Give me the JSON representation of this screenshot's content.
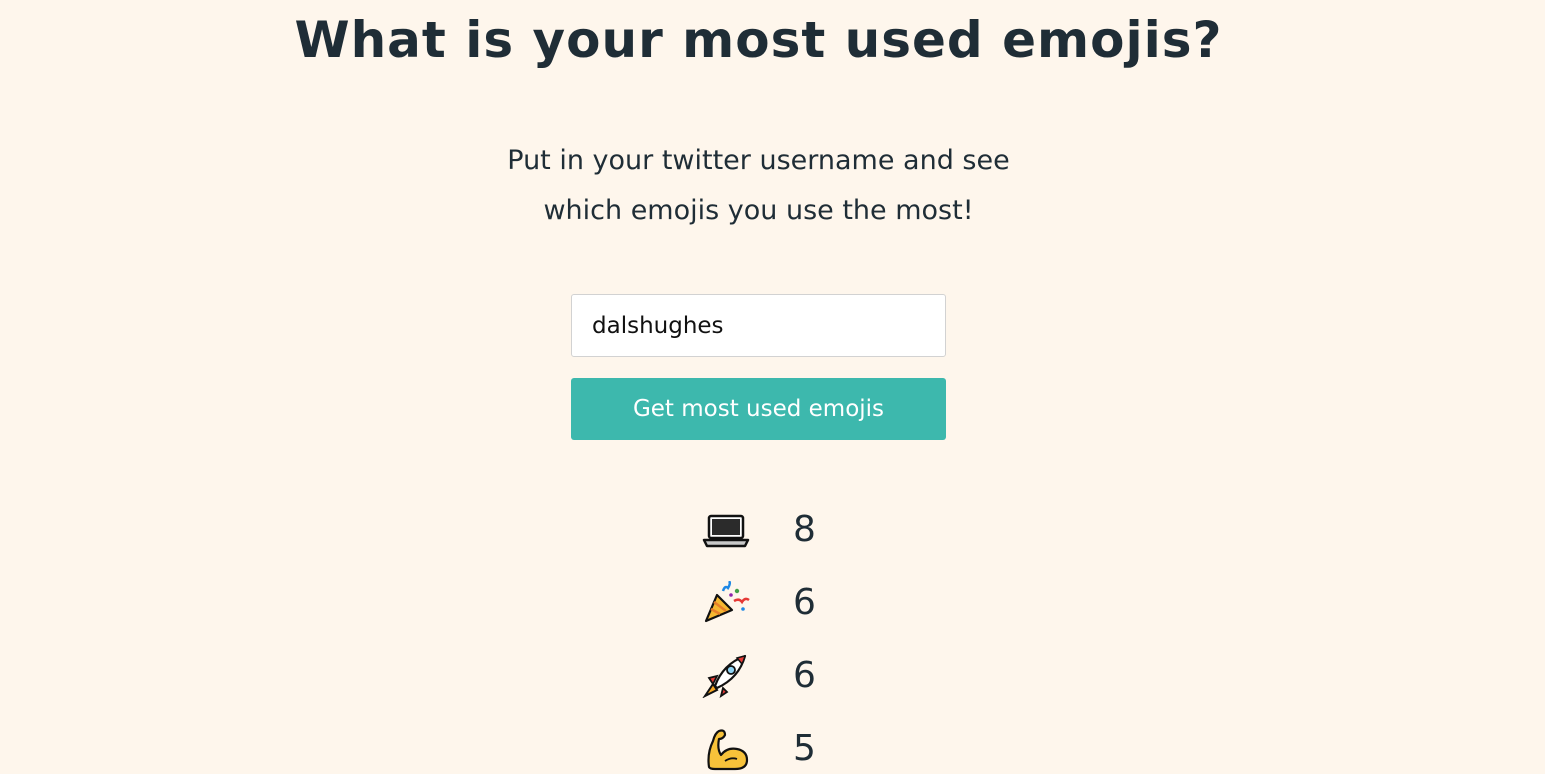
{
  "page": {
    "title": "What is your most used emojis?",
    "subtitle_line1": "Put in your twitter username and see",
    "subtitle_line2": "which emojis you use the most!"
  },
  "form": {
    "username_value": "dalshughes",
    "button_label": "Get most used emojis"
  },
  "results": [
    {
      "emoji": "laptop-icon",
      "count": "8"
    },
    {
      "emoji": "party-popper-icon",
      "count": "6"
    },
    {
      "emoji": "rocket-icon",
      "count": "6"
    },
    {
      "emoji": "flexed-biceps-icon",
      "count": "5"
    }
  ],
  "colors": {
    "background": "#fef6ec",
    "text": "#1f2d36",
    "button": "#3db8ad"
  }
}
